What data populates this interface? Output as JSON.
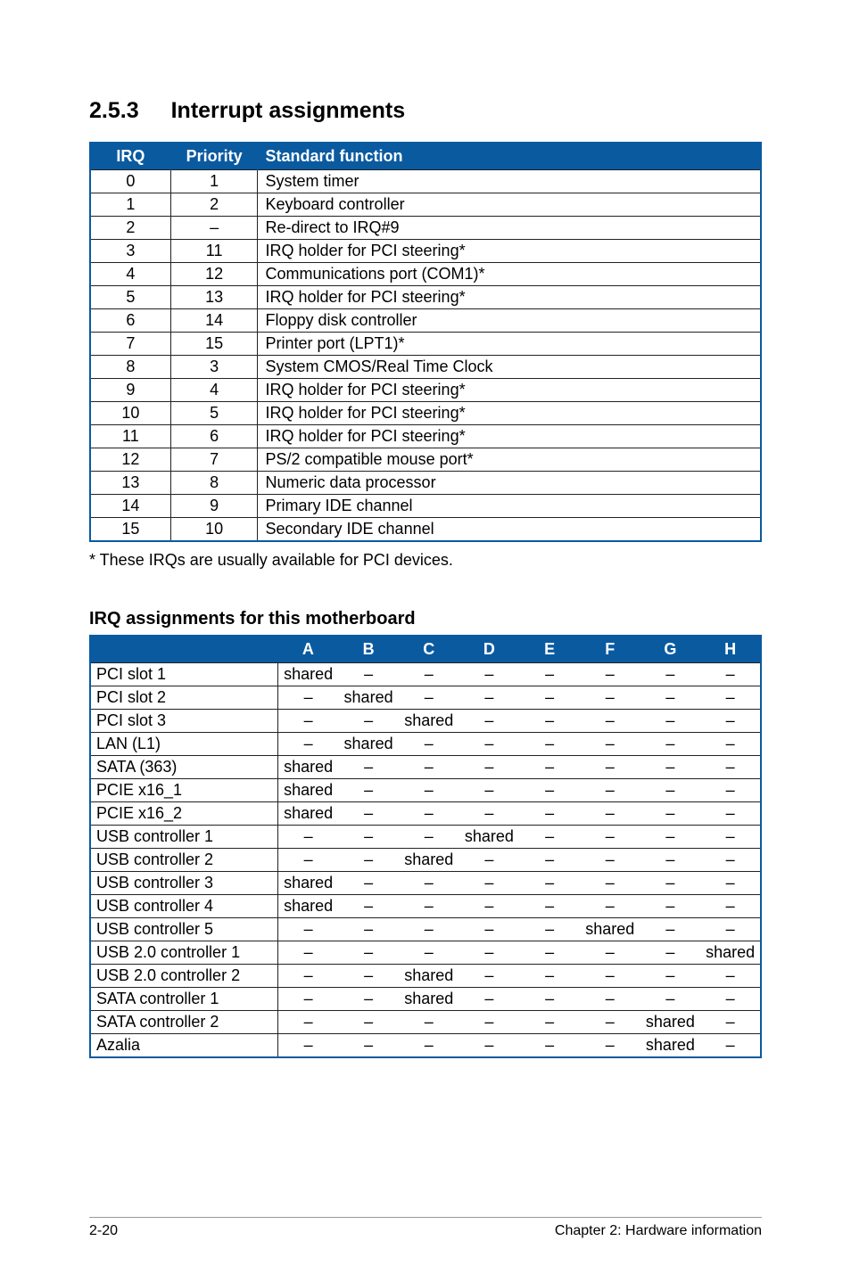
{
  "section": {
    "number": "2.5.3",
    "title": "Interrupt assignments"
  },
  "irq_table": {
    "headers": {
      "irq": "IRQ",
      "priority": "Priority",
      "fn": "Standard function"
    },
    "rows": [
      {
        "irq": "0",
        "priority": "1",
        "fn": "System timer"
      },
      {
        "irq": "1",
        "priority": "2",
        "fn": "Keyboard controller"
      },
      {
        "irq": "2",
        "priority": "–",
        "fn": "Re-direct to IRQ#9"
      },
      {
        "irq": "3",
        "priority": "11",
        "fn": "IRQ holder for PCI steering*"
      },
      {
        "irq": "4",
        "priority": "12",
        "fn": "Communications port (COM1)*"
      },
      {
        "irq": "5",
        "priority": "13",
        "fn": "IRQ holder for PCI steering*"
      },
      {
        "irq": "6",
        "priority": "14",
        "fn": "Floppy disk controller"
      },
      {
        "irq": "7",
        "priority": "15",
        "fn": "Printer port (LPT1)*"
      },
      {
        "irq": "8",
        "priority": "3",
        "fn": "System CMOS/Real Time Clock"
      },
      {
        "irq": "9",
        "priority": "4",
        "fn": "IRQ holder for PCI steering*"
      },
      {
        "irq": "10",
        "priority": "5",
        "fn": "IRQ holder for PCI steering*"
      },
      {
        "irq": "11",
        "priority": "6",
        "fn": "IRQ holder for PCI steering*"
      },
      {
        "irq": "12",
        "priority": "7",
        "fn": "PS/2 compatible mouse port*"
      },
      {
        "irq": "13",
        "priority": "8",
        "fn": "Numeric data processor"
      },
      {
        "irq": "14",
        "priority": "9",
        "fn": "Primary IDE channel"
      },
      {
        "irq": "15",
        "priority": "10",
        "fn": "Secondary IDE channel"
      }
    ]
  },
  "footnote": "* These IRQs are usually available for PCI devices.",
  "subheading": "IRQ assignments for this motherboard",
  "assign_table": {
    "headers": {
      "dev": "",
      "A": "A",
      "B": "B",
      "C": "C",
      "D": "D",
      "E": "E",
      "F": "F",
      "G": "G",
      "H": "H"
    },
    "rows": [
      {
        "dev": "PCI slot 1",
        "A": "shared",
        "B": "–",
        "C": "–",
        "D": "–",
        "E": "–",
        "F": "–",
        "G": "–",
        "H": "–"
      },
      {
        "dev": "PCI slot 2",
        "A": "–",
        "B": "shared",
        "C": "–",
        "D": "–",
        "E": "–",
        "F": "–",
        "G": "–",
        "H": "–"
      },
      {
        "dev": "PCI slot 3",
        "A": "–",
        "B": "–",
        "C": "shared",
        "D": "–",
        "E": "–",
        "F": "–",
        "G": "–",
        "H": "–"
      },
      {
        "dev": "LAN (L1)",
        "A": "–",
        "B": "shared",
        "C": "–",
        "D": "–",
        "E": "–",
        "F": "–",
        "G": "–",
        "H": "–"
      },
      {
        "dev": "SATA (363)",
        "A": "shared",
        "B": "–",
        "C": "–",
        "D": "–",
        "E": "–",
        "F": "–",
        "G": "–",
        "H": "–"
      },
      {
        "dev": "PCIE x16_1",
        "A": "shared",
        "B": "–",
        "C": "–",
        "D": "–",
        "E": "–",
        "F": "–",
        "G": "–",
        "H": "–"
      },
      {
        "dev": "PCIE x16_2",
        "A": "shared",
        "B": "–",
        "C": "–",
        "D": "–",
        "E": "–",
        "F": "–",
        "G": "–",
        "H": "–"
      },
      {
        "dev": "USB controller 1",
        "A": "–",
        "B": "–",
        "C": "–",
        "D": "shared",
        "E": "–",
        "F": "–",
        "G": "–",
        "H": "–"
      },
      {
        "dev": "USB controller 2",
        "A": "–",
        "B": "–",
        "C": "shared",
        "D": "–",
        "E": "–",
        "F": "–",
        "G": "–",
        "H": "–"
      },
      {
        "dev": "USB controller 3",
        "A": "shared",
        "B": "–",
        "C": "–",
        "D": "–",
        "E": "–",
        "F": "–",
        "G": "–",
        "H": "–"
      },
      {
        "dev": "USB controller 4",
        "A": "shared",
        "B": "–",
        "C": "–",
        "D": "–",
        "E": "–",
        "F": "–",
        "G": "–",
        "H": "–"
      },
      {
        "dev": "USB controller 5",
        "A": "–",
        "B": "–",
        "C": "–",
        "D": "–",
        "E": "–",
        "F": "shared",
        "G": "–",
        "H": "–"
      },
      {
        "dev": "USB 2.0 controller 1",
        "A": "–",
        "B": "–",
        "C": "–",
        "D": "–",
        "E": "–",
        "F": "–",
        "G": "–",
        "H": "shared"
      },
      {
        "dev": "USB 2.0 controller 2",
        "A": "–",
        "B": "–",
        "C": "shared",
        "D": "–",
        "E": "–",
        "F": "–",
        "G": "–",
        "H": "–"
      },
      {
        "dev": "SATA controller 1",
        "A": "–",
        "B": "–",
        "C": "shared",
        "D": "–",
        "E": "–",
        "F": "–",
        "G": "–",
        "H": "–"
      },
      {
        "dev": "SATA controller 2",
        "A": "–",
        "B": "–",
        "C": "–",
        "D": "–",
        "E": "–",
        "F": "–",
        "G": "shared",
        "H": "–"
      },
      {
        "dev": "Azalia",
        "A": "–",
        "B": "–",
        "C": "–",
        "D": "–",
        "E": "–",
        "F": "–",
        "G": "shared",
        "H": "–"
      }
    ]
  },
  "footer": {
    "left": "2-20",
    "right": "Chapter 2: Hardware information"
  }
}
